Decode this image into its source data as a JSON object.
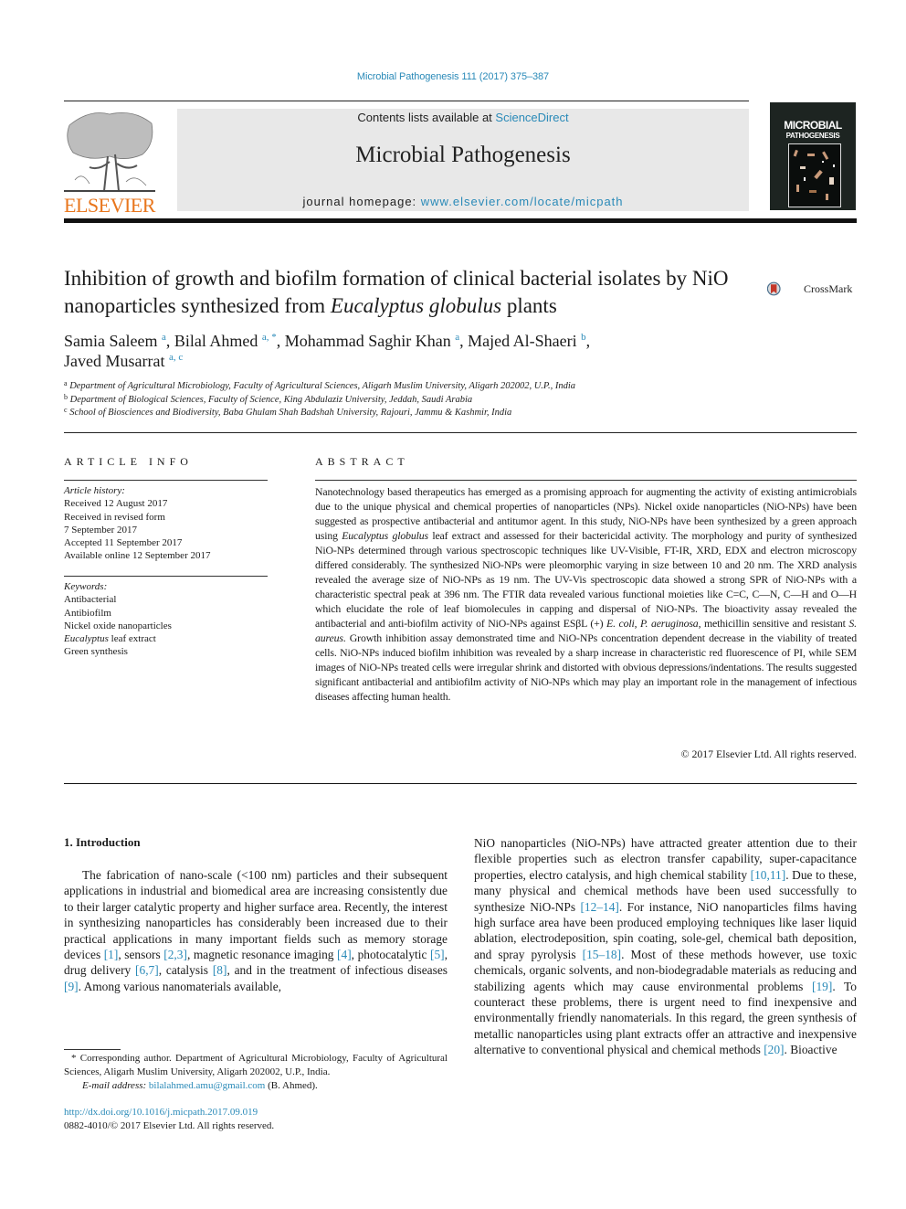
{
  "header": {
    "journal_reference": "Microbial Pathogenesis 111 (2017) 375–387",
    "contents_prefix": "Contents lists available at ",
    "contents_link": "ScienceDirect",
    "journal_name": "Microbial Pathogenesis",
    "homepage_prefix": "journal homepage: ",
    "homepage_link": "www.elsevier.com/locate/micpath",
    "publisher_logo_text": "ELSEVIER",
    "cover_title_line1": "MICROBIAL",
    "cover_title_line2": "PATHOGENESIS"
  },
  "colors": {
    "link": "#2a8ab8",
    "elsevier_orange": "#e8761d",
    "banner_gray": "#e8e8e8"
  },
  "article": {
    "title_part1": "Inhibition of growth and biofilm formation of clinical bacterial isolates by NiO nanoparticles synthesized from ",
    "title_italic": "Eucalyptus globulus",
    "title_part2": " plants",
    "crossmark_label": "CrossMark",
    "authors": [
      {
        "name": "Samia Saleem",
        "aff": "a",
        "sep": ", "
      },
      {
        "name": "Bilal Ahmed",
        "aff": "a, *",
        "sep": ", "
      },
      {
        "name": "Mohammad Saghir Khan",
        "aff": "a",
        "sep": ", "
      },
      {
        "name": "Majed Al-Shaeri",
        "aff": "b",
        "sep": ","
      },
      {
        "name": "Javed Musarrat",
        "aff": "a, c",
        "sep": ""
      }
    ],
    "affiliations": [
      {
        "mark": "a",
        "text": "Department of Agricultural Microbiology, Faculty of Agricultural Sciences, Aligarh Muslim University, Aligarh 202002, U.P., India"
      },
      {
        "mark": "b",
        "text": "Department of Biological Sciences, Faculty of Science, King Abdulaziz University, Jeddah, Saudi Arabia"
      },
      {
        "mark": "c",
        "text": "School of Biosciences and Biodiversity, Baba Ghulam Shah Badshah University, Rajouri, Jammu & Kashmir, India"
      }
    ]
  },
  "article_info": {
    "heading": "ARTICLE INFO",
    "history_label": "Article history:",
    "history": [
      "Received 12 August 2017",
      "Received in revised form",
      "7 September 2017",
      "Accepted 11 September 2017",
      "Available online 12 September 2017"
    ],
    "keywords_label": "Keywords:",
    "keywords": [
      "Antibacterial",
      "Antibiofilm",
      "Nickel oxide nanoparticles",
      "Eucalyptus leaf extract",
      "Green synthesis"
    ]
  },
  "abstract": {
    "heading": "ABSTRACT",
    "text": "Nanotechnology based therapeutics has emerged as a promising approach for augmenting the activity of existing antimicrobials due to the unique physical and chemical properties of nanoparticles (NPs). Nickel oxide nanoparticles (NiO-NPs) have been suggested as prospective antibacterial and antitumor agent. In this study, NiO-NPs have been synthesized by a green approach using Eucalyptus globulus leaf extract and assessed for their bactericidal activity. The morphology and purity of synthesized NiO-NPs determined through various spectroscopic techniques like UV-Visible, FT-IR, XRD, EDX and electron microscopy differed considerably. The synthesized NiO-NPs were pleomorphic varying in size between 10 and 20 nm. The XRD analysis revealed the average size of NiO-NPs as 19 nm. The UV-Vis spectroscopic data showed a strong SPR of NiO-NPs with a characteristic spectral peak at 396 nm. The FTIR data revealed various functional moieties like C=C, C—N, C—H and O—H which elucidate the role of leaf biomolecules in capping and dispersal of NiO-NPs. The bioactivity assay revealed the antibacterial and anti-biofilm activity of NiO-NPs against ESβL (+) E. coli, P. aeruginosa, methicillin sensitive and resistant S. aureus. Growth inhibition assay demonstrated time and NiO-NPs concentration dependent decrease in the viability of treated cells. NiO-NPs induced biofilm inhibition was revealed by a sharp increase in characteristic red fluorescence of PI, while SEM images of NiO-NPs treated cells were irregular shrink and distorted with obvious depressions/indentations. The results suggested significant antibacterial and antibiofilm activity of NiO-NPs which may play an important role in the management of infectious diseases affecting human health.",
    "segments": [
      {
        "t": "Nanotechnology based therapeutics has emerged as a promising approach for augmenting the activity of existing antimicrobials due to the unique physical and chemical properties of nanoparticles (NPs). Nickel oxide nanoparticles (NiO-NPs) have been suggested as prospective antibacterial and antitumor agent. In this study, NiO-NPs have been synthesized by a green approach using ",
        "i": false
      },
      {
        "t": "Eucalyptus globulus",
        "i": true
      },
      {
        "t": " leaf extract and assessed for their bactericidal activity. The morphology and purity of synthesized NiO-NPs determined through various spectroscopic techniques like UV-Visible, FT-IR, XRD, EDX and electron microscopy differed considerably. The synthesized NiO-NPs were pleomorphic varying in size between 10 and 20 nm. The XRD analysis revealed the average size of NiO-NPs as 19 nm. The UV-Vis spectroscopic data showed a strong SPR of NiO-NPs with a characteristic spectral peak at 396 nm. The FTIR data revealed various functional moieties like C=C, C—N, C—H and O—H which elucidate the role of leaf biomolecules in capping and dispersal of NiO-NPs. The bioactivity assay revealed the antibacterial and anti-biofilm activity of NiO-NPs against ESβL (+) ",
        "i": false
      },
      {
        "t": "E. coli",
        "i": true
      },
      {
        "t": ", ",
        "i": false
      },
      {
        "t": "P. aeruginosa",
        "i": true
      },
      {
        "t": ", methicillin sensitive and resistant ",
        "i": false
      },
      {
        "t": "S. aureus",
        "i": true
      },
      {
        "t": ". Growth inhibition assay demonstrated time and NiO-NPs concentration dependent decrease in the viability of treated cells. NiO-NPs induced biofilm inhibition was revealed by a sharp increase in char­acteristic red fluorescence of PI, while SEM images of NiO-NPs treated cells were irregular shrink and distorted with obvious depressions/indentations. The results suggested significant antibacterial and antibiofilm activity of NiO-NPs which may play an important role in the management of infectious diseases affecting human health.",
        "i": false
      }
    ],
    "copyright": "© 2017 Elsevier Ltd. All rights reserved."
  },
  "body": {
    "section_heading": "1.  Introduction",
    "left_segments": [
      {
        "t": "The fabrication of nano-scale (<100 nm) particles and their subsequent applications in industrial and biomedical area are increasing consistently due to their larger catalytic property and higher surface area. Recently, the interest in synthesizing nano­particles has considerably been increased due to their practical applications in many important fields such as memory storage devices ",
        "r": false
      },
      {
        "t": "[1]",
        "r": true
      },
      {
        "t": ", sensors ",
        "r": false
      },
      {
        "t": "[2,3]",
        "r": true
      },
      {
        "t": ", magnetic resonance imaging ",
        "r": false
      },
      {
        "t": "[4]",
        "r": true
      },
      {
        "t": ", photo­catalytic ",
        "r": false
      },
      {
        "t": "[5]",
        "r": true
      },
      {
        "t": ", drug delivery ",
        "r": false
      },
      {
        "t": "[6,7]",
        "r": true
      },
      {
        "t": ", catalysis ",
        "r": false
      },
      {
        "t": "[8]",
        "r": true
      },
      {
        "t": ", and in the treatment of infectious diseases ",
        "r": false
      },
      {
        "t": "[9]",
        "r": true
      },
      {
        "t": ". Among various nanomaterials available,",
        "r": false
      }
    ],
    "right_segments": [
      {
        "t": "NiO nanoparticles (NiO-NPs) have attracted greater attention due to their flexible properties such as electron transfer capability, super-capacitance properties, electro catalysis, and high chemical stability ",
        "r": false
      },
      {
        "t": "[10,11]",
        "r": true
      },
      {
        "t": ". Due to these, many physical and chemical methods have been used successfully to synthesize NiO-NPs ",
        "r": false
      },
      {
        "t": "[12–14]",
        "r": true
      },
      {
        "t": ". For instance, NiO nanoparticles films having high surface area have been produced employing techniques like laser liquid ablation, electrodeposition, spin coating, sole-gel, chemical bath deposition, and spray pyrolysis ",
        "r": false
      },
      {
        "t": "[15–18]",
        "r": true
      },
      {
        "t": ". Most of these methods however, use toxic chemicals, organic solvents, and non-biodegradable materials as reducing and stabilizing agents which may cause environmental problems ",
        "r": false
      },
      {
        "t": "[19]",
        "r": true
      },
      {
        "t": ". To counteract these problems, there is urgent need to find inexpensive and environmentally friendly nanomaterials. In this regard, the green synthesis of metallic nanoparticles using plant extracts offer an attractive and inexpensive alternative to conventional physical and chemical methods ",
        "r": false
      },
      {
        "t": "[20]",
        "r": true
      },
      {
        "t": ". Bioactive",
        "r": false
      }
    ]
  },
  "footnote": {
    "corresponding": "* Corresponding author. Department of Agricultural Microbiology, Faculty of Agricultural Sciences, Aligarh Muslim University, Aligarh 202002, U.P., India.",
    "email_label": "E-mail address: ",
    "email": "bilalahmed.amu@gmail.com",
    "email_suffix": " (B. Ahmed).",
    "doi": "http://dx.doi.org/10.1016/j.micpath.2017.09.019",
    "issn_line": "0882-4010/© 2017 Elsevier Ltd. All rights reserved."
  }
}
